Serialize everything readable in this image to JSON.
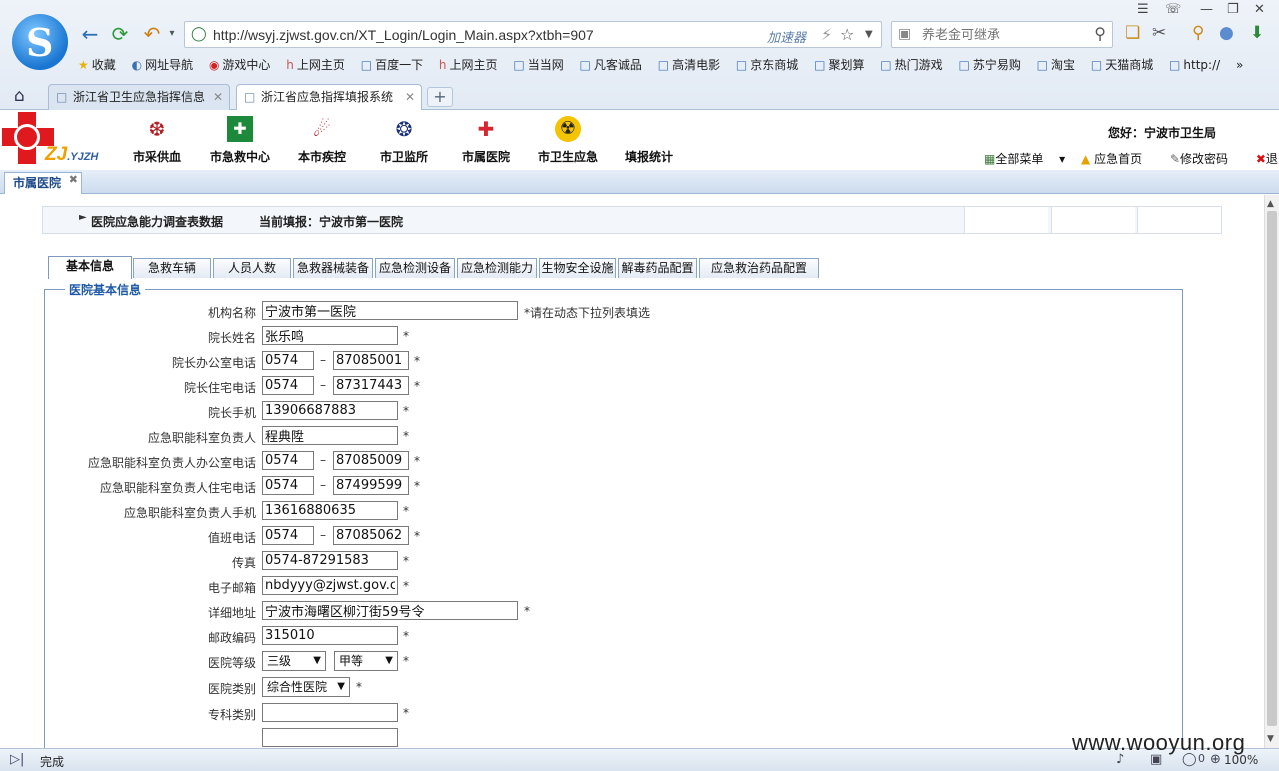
{
  "browser": {
    "url": "http://wsyj.zjwst.gov.cn/XT_Login/Login_Main.aspx?xtbh=907",
    "accelerator": "加速器",
    "search_placeholder": "养老金可继承",
    "bookmarks": [
      "收藏",
      "网址导航",
      "游戏中心",
      "上网主页",
      "百度一下",
      "上网主页",
      "当当网",
      "凡客诚品",
      "高清电影",
      "京东商城",
      "聚划算",
      "热门游戏",
      "苏宁易购",
      "淘宝",
      "天猫商城",
      "http://"
    ],
    "tabs": [
      {
        "title": "浙江省卫生应急指挥信息"
      },
      {
        "title": "浙江省应急指挥填报系统"
      }
    ],
    "status": "完成",
    "zoom": "100%",
    "status_count": "0"
  },
  "app": {
    "brand": "ZJ",
    "brand_sub": ".YJZH",
    "modules": [
      "市采供血",
      "市急救中心",
      "本市疾控",
      "市卫监所",
      "市属医院",
      "市卫生应急",
      "填报统计"
    ],
    "greeting": "您好：宁波市卫生局",
    "links": {
      "menu": "全部菜单",
      "home": "应急首页",
      "password": "修改密码",
      "logout": "退出"
    },
    "module_tab": "市属医院"
  },
  "page": {
    "section_title": "医院应急能力调查表数据",
    "current_report": "当前填报：宁波市第一医院",
    "form_tabs": [
      "基本信息",
      "急救车辆",
      "人员人数",
      "急救器械装备",
      "应急检测设备",
      "应急检测能力",
      "生物安全设施",
      "解毒药品配置",
      "应急救治药品配置"
    ],
    "legend": "医院基本信息"
  },
  "form": {
    "org_name": {
      "label": "机构名称",
      "value": "宁波市第一医院",
      "note": "*请在动态下拉列表填选"
    },
    "director_name": {
      "label": "院长姓名",
      "value": "张乐鸣"
    },
    "director_office_tel": {
      "label": "院长办公室电话",
      "area": "0574",
      "number": "87085001"
    },
    "director_home_tel": {
      "label": "院长住宅电话",
      "area": "0574",
      "number": "87317443"
    },
    "director_mobile": {
      "label": "院长手机",
      "value": "13906687883"
    },
    "emergency_head": {
      "label": "应急职能科室负责人",
      "value": "程典陞"
    },
    "emergency_office_tel": {
      "label": "应急职能科室负责人办公室电话",
      "area": "0574",
      "number": "87085009"
    },
    "emergency_home_tel": {
      "label": "应急职能科室负责人住宅电话",
      "area": "0574",
      "number": "87499599"
    },
    "emergency_mobile": {
      "label": "应急职能科室负责人手机",
      "value": "13616880635"
    },
    "duty_tel": {
      "label": "值班电话",
      "area": "0574",
      "number": "87085062"
    },
    "fax": {
      "label": "传真",
      "value": "0574-87291583"
    },
    "email": {
      "label": "电子邮箱",
      "value": "nbdyyy@zjwst.gov.cn"
    },
    "address": {
      "label": "详细地址",
      "value": "宁波市海曙区柳汀街59号令"
    },
    "postcode": {
      "label": "邮政编码",
      "value": "315010"
    },
    "hospital_grade": {
      "label": "医院等级",
      "level": "三级",
      "class": "甲等"
    },
    "hospital_type": {
      "label": "医院类别",
      "value": "综合性医院"
    },
    "specialty": {
      "label": "专科类别",
      "value": ""
    },
    "required_mark": "*"
  },
  "watermark": "www.wooyun.org"
}
